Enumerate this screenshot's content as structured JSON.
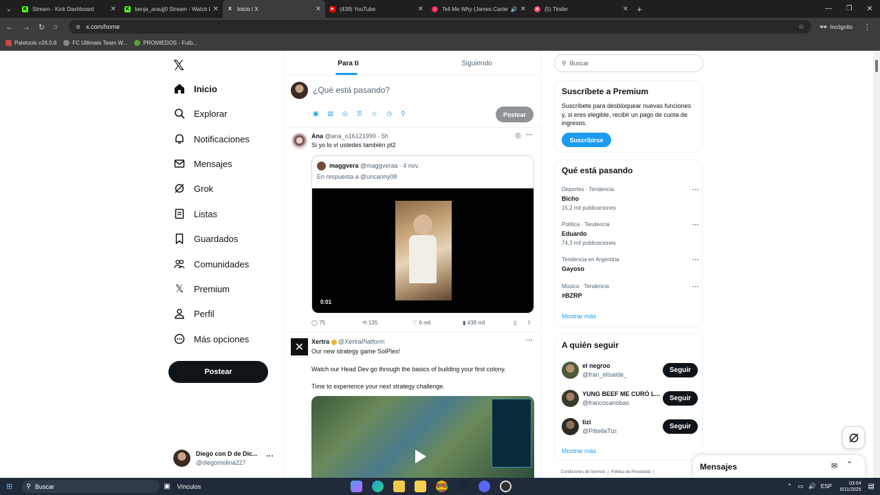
{
  "browser": {
    "tabs": [
      {
        "title": "Stream - Kick Dashboard",
        "color": "#53fc18",
        "glyph": "K"
      },
      {
        "title": "benja_araujj0 Stream - Watch Li",
        "color": "#53fc18",
        "glyph": "K"
      },
      {
        "title": "Inicio / X",
        "color": "#ffffff",
        "glyph": "X"
      },
      {
        "title": "(439) YouTube",
        "color": "#ff0000",
        "glyph": "▶"
      },
      {
        "title": "Tell Me Why (James Carter",
        "color": "#ff2a55",
        "glyph": "♪"
      },
      {
        "title": "(5) Tinder",
        "color": "#fd5068",
        "glyph": "♦"
      }
    ],
    "url": "x.com/home",
    "incognito": "Incógnito",
    "bookmarks": [
      "Paletools v26.0.8",
      "FC Ultimate Team W...",
      "PROMIEDOS - Futb..."
    ]
  },
  "sidebar": {
    "items": [
      "Inicio",
      "Explorar",
      "Notificaciones",
      "Mensajes",
      "Grok",
      "Listas",
      "Guardados",
      "Comunidades",
      "Premium",
      "Perfil",
      "Más opciones"
    ],
    "post_button": "Postear",
    "account_name": "Diego con D de Dic...",
    "account_handle": "@diegomolina227"
  },
  "main": {
    "tabs": [
      "Para ti",
      "Siguiendo"
    ],
    "compose_placeholder": "¿Qué está pasando?",
    "compose_button": "Postear",
    "tweet1": {
      "name": "Ana",
      "handle": "@ana_o16121999",
      "time": "· 5h",
      "text": "Si yo lo ví ustedes también pt2",
      "quote_name": "maggvera",
      "quote_handle": "@maggveraa",
      "quote_time": "· 4 nov.",
      "reply_to": "En respuesta a @uncanny08",
      "video_time": "0:01",
      "replies": "75",
      "retweets": "135",
      "likes": "6 mil",
      "views": "438 mil"
    },
    "tweet2": {
      "name": "Xertra",
      "handle": "@XertraPlatform",
      "line1": "Our new strategy game SolPlex!",
      "line2": "Watch our Head Dev go through the basics of building your first colony.",
      "line3": "Time to experience your next strategy challenge."
    }
  },
  "right": {
    "search_placeholder": "Buscar",
    "premium_title": "Suscríbete a Premium",
    "premium_text": "Suscríbete para desbloquear nuevas funciones y, si eres elegible, recibir un pago de cuota de ingresos.",
    "premium_button": "Suscribirse",
    "trends_title": "Qué está pasando",
    "trends": [
      {
        "category": "Deportes · Tendencia",
        "name": "Bicho",
        "count": "15,2 mil publicaciones"
      },
      {
        "category": "Política · Tendencia",
        "name": "Eduardo",
        "count": "74,3 mil publicaciones"
      },
      {
        "category": "Tendencia en Argentina",
        "name": "Gayoso",
        "count": ""
      },
      {
        "category": "Música · Tendencia",
        "name": "#BZRP",
        "count": ""
      }
    ],
    "show_more": "Mostrar más",
    "follow_title": "A quién seguir",
    "follow": [
      {
        "name": "el negroo",
        "handle": "@fran_elisalde_",
        "button": "Seguir"
      },
      {
        "name": "YUNG BEEF ME CURÓ L...",
        "handle": "@francocanobas",
        "button": "Seguir"
      },
      {
        "name": "tizi",
        "handle": "@PittellaTizi",
        "button": "Seguir"
      }
    ],
    "show_more2": "Mostrar más",
    "footer": "Condiciones de Servicio  |  Política de Privacidad  |",
    "messages": "Mensajes"
  },
  "taskbar": {
    "search": "Buscar",
    "vinculos": "Vínculos",
    "lang": "ESP",
    "time": "03:04",
    "date": "6/11/2025"
  }
}
